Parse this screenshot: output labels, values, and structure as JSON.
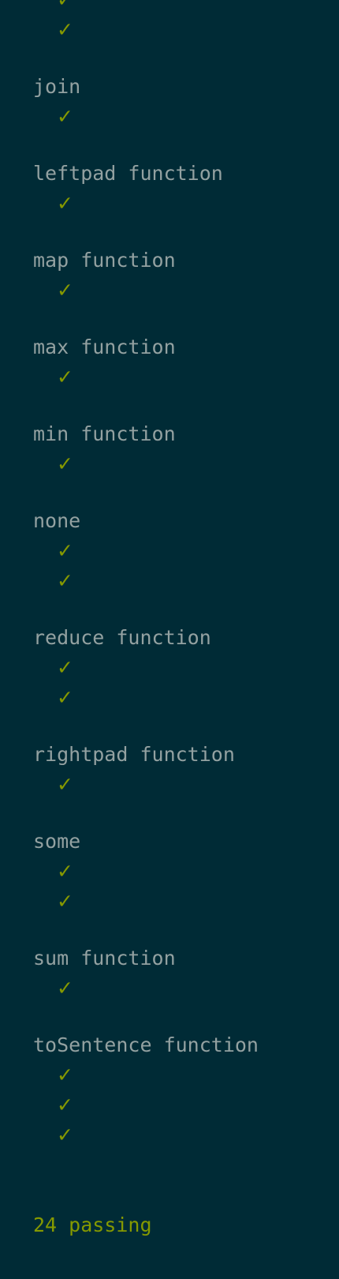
{
  "terminal": {
    "check_mark": "✓",
    "summary": "24 passing",
    "suites": [
      {
        "name": "",
        "tests": 2
      },
      {
        "name": "join",
        "tests": 1
      },
      {
        "name": "leftpad function",
        "tests": 1
      },
      {
        "name": "map function",
        "tests": 1
      },
      {
        "name": "max function",
        "tests": 1
      },
      {
        "name": "min function",
        "tests": 1
      },
      {
        "name": "none",
        "tests": 2
      },
      {
        "name": "reduce function",
        "tests": 2
      },
      {
        "name": "rightpad function",
        "tests": 1
      },
      {
        "name": "some",
        "tests": 2
      },
      {
        "name": "sum function",
        "tests": 1
      },
      {
        "name": "toSentence function",
        "tests": 3
      }
    ]
  },
  "colors": {
    "background": "#002b36",
    "suite_text": "#93a1a1",
    "pass": "#859900"
  }
}
